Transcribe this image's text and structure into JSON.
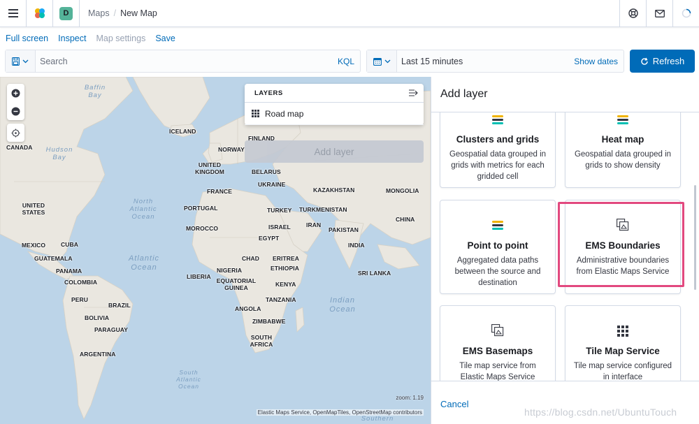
{
  "header": {
    "breadcrumbs": [
      "Maps",
      "New Map"
    ],
    "space_initial": "D",
    "accent": "#006bb8"
  },
  "topnav": {
    "full_screen": "Full screen",
    "inspect": "Inspect",
    "map_settings": "Map settings",
    "save": "Save"
  },
  "query": {
    "search_placeholder": "Search",
    "kql": "KQL",
    "date_range": "Last 15 minutes",
    "show_dates": "Show dates",
    "refresh": "Refresh"
  },
  "map": {
    "zoom_readout": "zoom: 1.19",
    "attribution": "Elastic Maps Service, OpenMapTiles, OpenStreetMap contributors",
    "countries": [
      "ICELAND",
      "CANADA",
      "FINLAND",
      "NORWAY",
      "UNITED KINGDOM",
      "BELARUS",
      "UKRAINE",
      "FRANCE",
      "KAZAKHSTAN",
      "MONGOLIA",
      "PORTUGAL",
      "TURKEY",
      "TURKMENISTAN",
      "UNITED STATES",
      "MOROCCO",
      "ISRAEL",
      "IRAN",
      "PAKISTAN",
      "CHINA",
      "EGYPT",
      "MEXICO",
      "CUBA",
      "GUATEMALA",
      "ERITREA",
      "INDIA",
      "CHAD",
      "PANAMA",
      "NIGERIA",
      "ETHIOPIA",
      "SRI LANKA",
      "COLOMBIA",
      "LIBERIA",
      "EQUATORIAL GUINEA",
      "KENYA",
      "PERU",
      "BRAZIL",
      "TANZANIA",
      "ANGOLA",
      "BOLIVIA",
      "ZIMBABWE",
      "PARAGUAY",
      "SOUTH AFRICA",
      "ARGENTINA"
    ],
    "seas": [
      "Baffin Bay",
      "Hudson Bay",
      "North Atlantic Ocean",
      "Atlantic Ocean",
      "Indian Ocean",
      "South Atlantic Ocean",
      "Southern"
    ]
  },
  "layers": {
    "title": "LAYERS",
    "items": [
      {
        "label": "Road map"
      }
    ],
    "add_layer": "Add layer"
  },
  "panel": {
    "title": "Add layer",
    "cards": [
      {
        "title": "Clusters and grids",
        "desc": "Geospatial data grouped in grids with metrics for each gridded cell"
      },
      {
        "title": "Heat map",
        "desc": "Geospatial data grouped in grids to show density"
      },
      {
        "title": "Point to point",
        "desc": "Aggregated data paths between the source and destination"
      },
      {
        "title": "EMS Boundaries",
        "desc": "Administrative boundaries from Elastic Maps Service"
      },
      {
        "title": "EMS Basemaps",
        "desc": "Tile map service from Elastic Maps Service"
      },
      {
        "title": "Tile Map Service",
        "desc": "Tile map service configured in interface"
      }
    ],
    "cancel": "Cancel",
    "highlight_color": "#e2497f"
  },
  "watermark": "https://blog.csdn.net/UbuntuTouch"
}
